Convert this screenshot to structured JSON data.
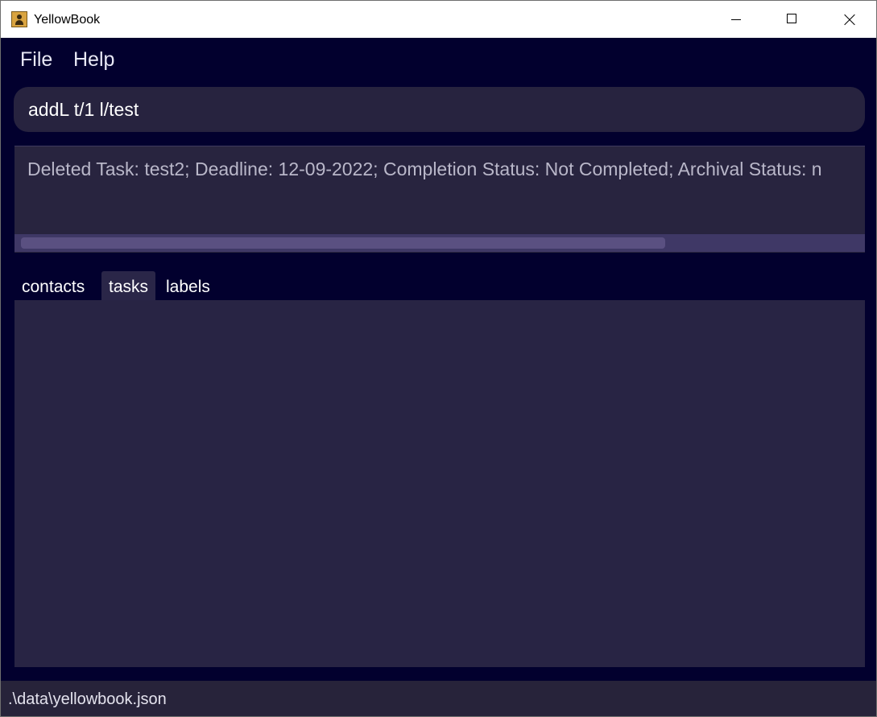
{
  "window": {
    "title": "YellowBook",
    "controls": [
      "minimize-icon",
      "maximize-icon",
      "close-icon"
    ]
  },
  "menu": {
    "file": "File",
    "help": "Help"
  },
  "command": {
    "value": "addL t/1 l/test"
  },
  "result": {
    "text": "Deleted Task: test2; Deadline: 12-09-2022; Completion Status: Not Completed; Archival Status: n"
  },
  "tabs": {
    "items": [
      {
        "label": "contacts",
        "selected": false
      },
      {
        "label": "tasks",
        "selected": true
      },
      {
        "label": "labels",
        "selected": false
      }
    ]
  },
  "status": {
    "path": ".\\data\\yellowbook.json"
  },
  "colors": {
    "background": "#02002e",
    "panel": "#28243f",
    "accent_tab": "#2a2648"
  }
}
